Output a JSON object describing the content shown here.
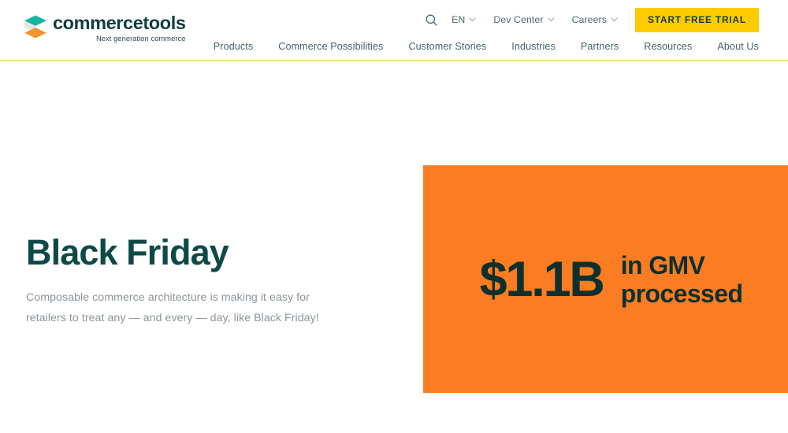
{
  "brand": {
    "logo_word": "commercetools",
    "logo_tagline": "Next generation commerce",
    "logo_icon": "commercetools-stacked-diamonds-logo",
    "colors": {
      "teal_dark": "#0d4a47",
      "teal_ink": "#0d302e",
      "orange": "#fb7c22",
      "yellow": "#fecb00",
      "logo_teal": "#19b5a0",
      "logo_orange": "#f3932f",
      "logo_gray": "#e3e5e3",
      "header_rule": "#f0dd8f",
      "nav_text": "#44616c",
      "body_text": "#8c9499"
    }
  },
  "header": {
    "search_icon": "search-icon",
    "utility": [
      {
        "label": "EN",
        "caret": "⌄",
        "has_caret": true
      },
      {
        "label": "Dev Center",
        "caret": "⌄",
        "has_caret": true
      },
      {
        "label": "Careers",
        "caret": "⌄",
        "has_caret": true
      }
    ],
    "cta_label": "START FREE TRIAL",
    "nav": [
      {
        "label": "Products"
      },
      {
        "label": "Commerce Possibilities"
      },
      {
        "label": "Customer Stories"
      },
      {
        "label": "Industries"
      },
      {
        "label": "Partners"
      },
      {
        "label": "Resources"
      },
      {
        "label": "About Us"
      }
    ]
  },
  "hero": {
    "title": "Black Friday",
    "subtitle": "Composable commerce architecture is making it easy for retailers to treat any — and every — day, like Black Friday!",
    "stat": {
      "figure": "$1.1B",
      "caption_line1": "in GMV",
      "caption_line2": "processed"
    }
  }
}
